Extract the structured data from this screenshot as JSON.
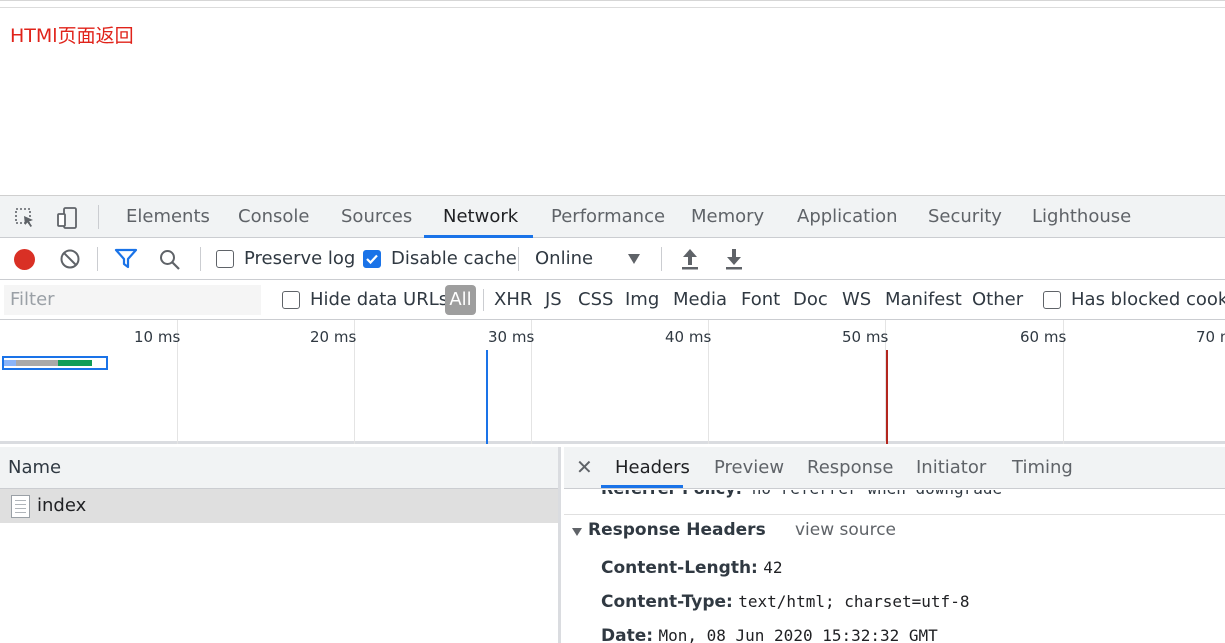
{
  "page": {
    "text": "HTMl页面返回"
  },
  "devtools": {
    "panel_tabs": [
      "Elements",
      "Console",
      "Sources",
      "Network",
      "Performance",
      "Memory",
      "Application",
      "Security",
      "Lighthouse"
    ],
    "active_tab": "Network",
    "toolbar": {
      "preserve_log": "Preserve log",
      "preserve_log_checked": false,
      "disable_cache": "Disable cache",
      "disable_cache_checked": true,
      "throttling": "Online"
    },
    "filterbar": {
      "filter_placeholder": "Filter",
      "hide_data_urls": "Hide data URLs",
      "types": [
        "All",
        "XHR",
        "JS",
        "CSS",
        "Img",
        "Media",
        "Font",
        "Doc",
        "WS",
        "Manifest",
        "Other"
      ],
      "selected_type": "All",
      "has_blocked_cookies": "Has blocked cookie"
    },
    "timeline": {
      "ticks": [
        "10 ms",
        "20 ms",
        "30 ms",
        "40 ms",
        "50 ms",
        "60 ms",
        "70 m"
      ],
      "dom_content_loaded_color": "#1a73e8",
      "load_color": "#b3261e"
    },
    "requests": {
      "column_name": "Name",
      "rows": [
        {
          "name": "index"
        }
      ]
    },
    "details": {
      "tabs": [
        "Headers",
        "Preview",
        "Response",
        "Initiator",
        "Timing"
      ],
      "active_tab": "Headers",
      "cut_row": {
        "key": "Referrer Policy:",
        "value": "no-referrer-when-downgrade"
      },
      "response_headers": {
        "title": "Response Headers",
        "view_source": "view source",
        "items": [
          {
            "key": "Content-Length:",
            "value": "42"
          },
          {
            "key": "Content-Type:",
            "value": "text/html; charset=utf-8"
          },
          {
            "key": "Date:",
            "value": "Mon, 08 Jun 2020 15:32:32 GMT"
          }
        ]
      }
    }
  }
}
